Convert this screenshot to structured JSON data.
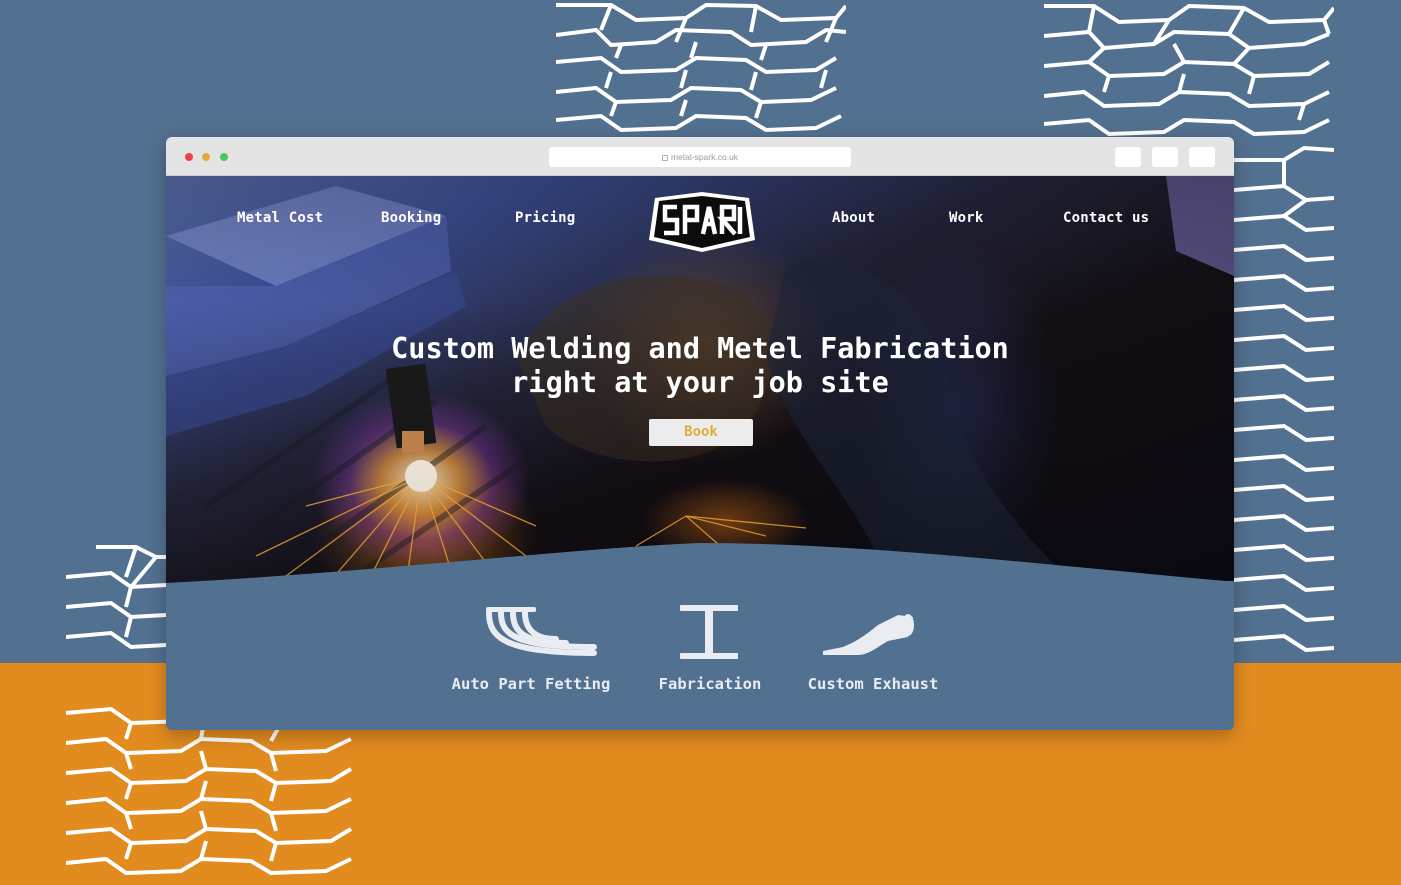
{
  "colors": {
    "background_blue": "#52708f",
    "background_orange": "#e28b1f",
    "book_button_text": "#e0ab3c",
    "nav_text": "#ffffff"
  },
  "browser": {
    "url": "metal-spark.co.uk"
  },
  "nav": {
    "left": [
      "Metal Cost",
      "Booking",
      "Pricing"
    ],
    "logo_text": "SPARK",
    "right": [
      "About",
      "Work",
      "Contact us"
    ]
  },
  "hero": {
    "headline_line1": "Custom Welding and Metel Fabrication",
    "headline_line2": "right at your job site",
    "book_label": "Book"
  },
  "services": [
    {
      "label": "Auto Part Fetting",
      "icon": "exhaust-manifold-icon"
    },
    {
      "label": "Fabrication",
      "icon": "i-beam-icon"
    },
    {
      "label": "Custom Exhaust",
      "icon": "exhaust-pipe-icon"
    }
  ]
}
